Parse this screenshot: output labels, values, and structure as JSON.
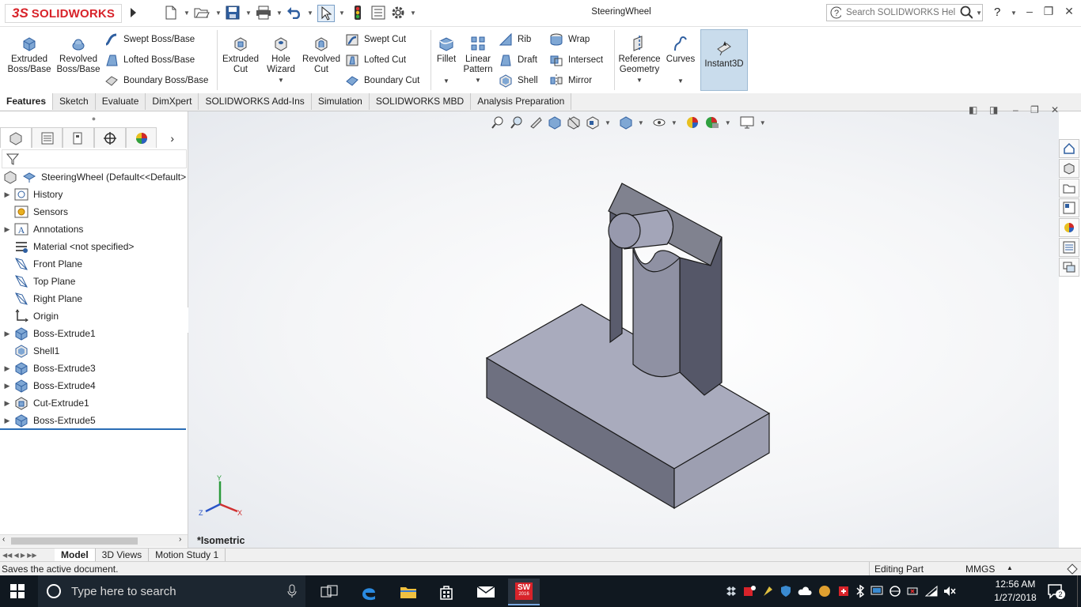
{
  "app": {
    "logo_ds": "3S",
    "logo_name": "SOLIDWORKS",
    "title": "SteeringWheel",
    "help_placeholder": "Search SOLIDWORKS Help",
    "help_question": "?"
  },
  "ribbon": {
    "extruded_boss": [
      "Extruded",
      "Boss/Base"
    ],
    "revolved_boss": [
      "Revolved",
      "Boss/Base"
    ],
    "swept_boss": "Swept Boss/Base",
    "lofted_boss": "Lofted Boss/Base",
    "boundary_boss": "Boundary Boss/Base",
    "extruded_cut": [
      "Extruded",
      "Cut"
    ],
    "hole_wizard": [
      "Hole",
      "Wizard"
    ],
    "revolved_cut": [
      "Revolved",
      "Cut"
    ],
    "swept_cut": "Swept Cut",
    "lofted_cut": "Lofted Cut",
    "boundary_cut": "Boundary Cut",
    "fillet": "Fillet",
    "linear_pattern": [
      "Linear",
      "Pattern"
    ],
    "rib": "Rib",
    "draft": "Draft",
    "shell": "Shell",
    "wrap": "Wrap",
    "intersect": "Intersect",
    "mirror": "Mirror",
    "reference_geometry": [
      "Reference",
      "Geometry"
    ],
    "curves": "Curves",
    "instant3d": "Instant3D"
  },
  "tabs": [
    "Features",
    "Sketch",
    "Evaluate",
    "DimXpert",
    "SOLIDWORKS Add-Ins",
    "Simulation",
    "SOLIDWORKS MBD",
    "Analysis Preparation"
  ],
  "tree": {
    "root": "SteeringWheel  (Default<<Default>",
    "items": [
      "History",
      "Sensors",
      "Annotations",
      "Material <not specified>",
      "Front Plane",
      "Top Plane",
      "Right Plane",
      "Origin",
      "Boss-Extrude1",
      "Shell1",
      "Boss-Extrude3",
      "Boss-Extrude4",
      "Cut-Extrude1",
      "Boss-Extrude5"
    ]
  },
  "viewport": {
    "view_name": "*Isometric",
    "triad": {
      "x": "X",
      "y": "Y",
      "z": "Z"
    }
  },
  "bottom_tabs": [
    "Model",
    "3D Views",
    "Motion Study 1"
  ],
  "status": {
    "message": "Saves the active document.",
    "mode": "Editing Part",
    "units": "MMGS"
  },
  "taskbar": {
    "search_placeholder": "Type here to search",
    "time": "12:56 AM",
    "date": "1/27/2018",
    "notifications": "2",
    "sw_badge": "SW",
    "sw_year": "2016"
  },
  "colors": {
    "brand_red": "#d8232a",
    "model_face_top": "#a9abbd",
    "model_face_side": "#5a5c6d",
    "selection_blue": "#c9dcec"
  }
}
